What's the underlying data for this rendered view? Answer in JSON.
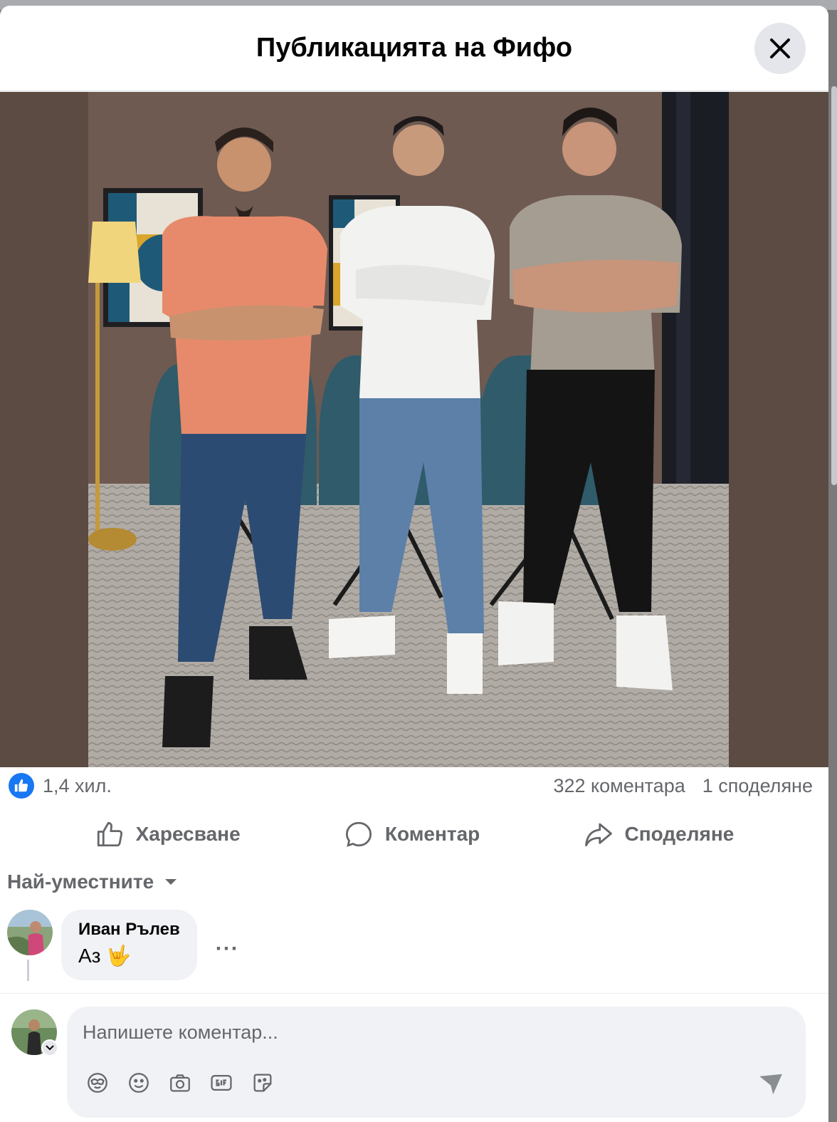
{
  "modal": {
    "title": "Публикацията на Фифо"
  },
  "stats": {
    "reactions": "1,4 хил.",
    "comments": "322 коментара",
    "shares": "1 споделяне"
  },
  "actions": {
    "like": "Харесване",
    "comment": "Коментар",
    "share": "Споделяне"
  },
  "sort": {
    "label": "Най-уместните"
  },
  "comments": [
    {
      "author": "Иван Рълев",
      "text": "Аз 🤟"
    }
  ],
  "composer": {
    "placeholder": "Напишете коментар..."
  },
  "colors": {
    "accent": "#1877f2",
    "muted_text": "#65676b",
    "bubble_bg": "#f0f2f5"
  },
  "icons": [
    "close-icon",
    "like-icon",
    "thumbs-up-icon",
    "comment-icon",
    "share-icon",
    "chevron-down-icon",
    "avatar-icon",
    "emoji-icon",
    "camera-icon",
    "gif-icon",
    "sticker-icon",
    "send-icon"
  ]
}
